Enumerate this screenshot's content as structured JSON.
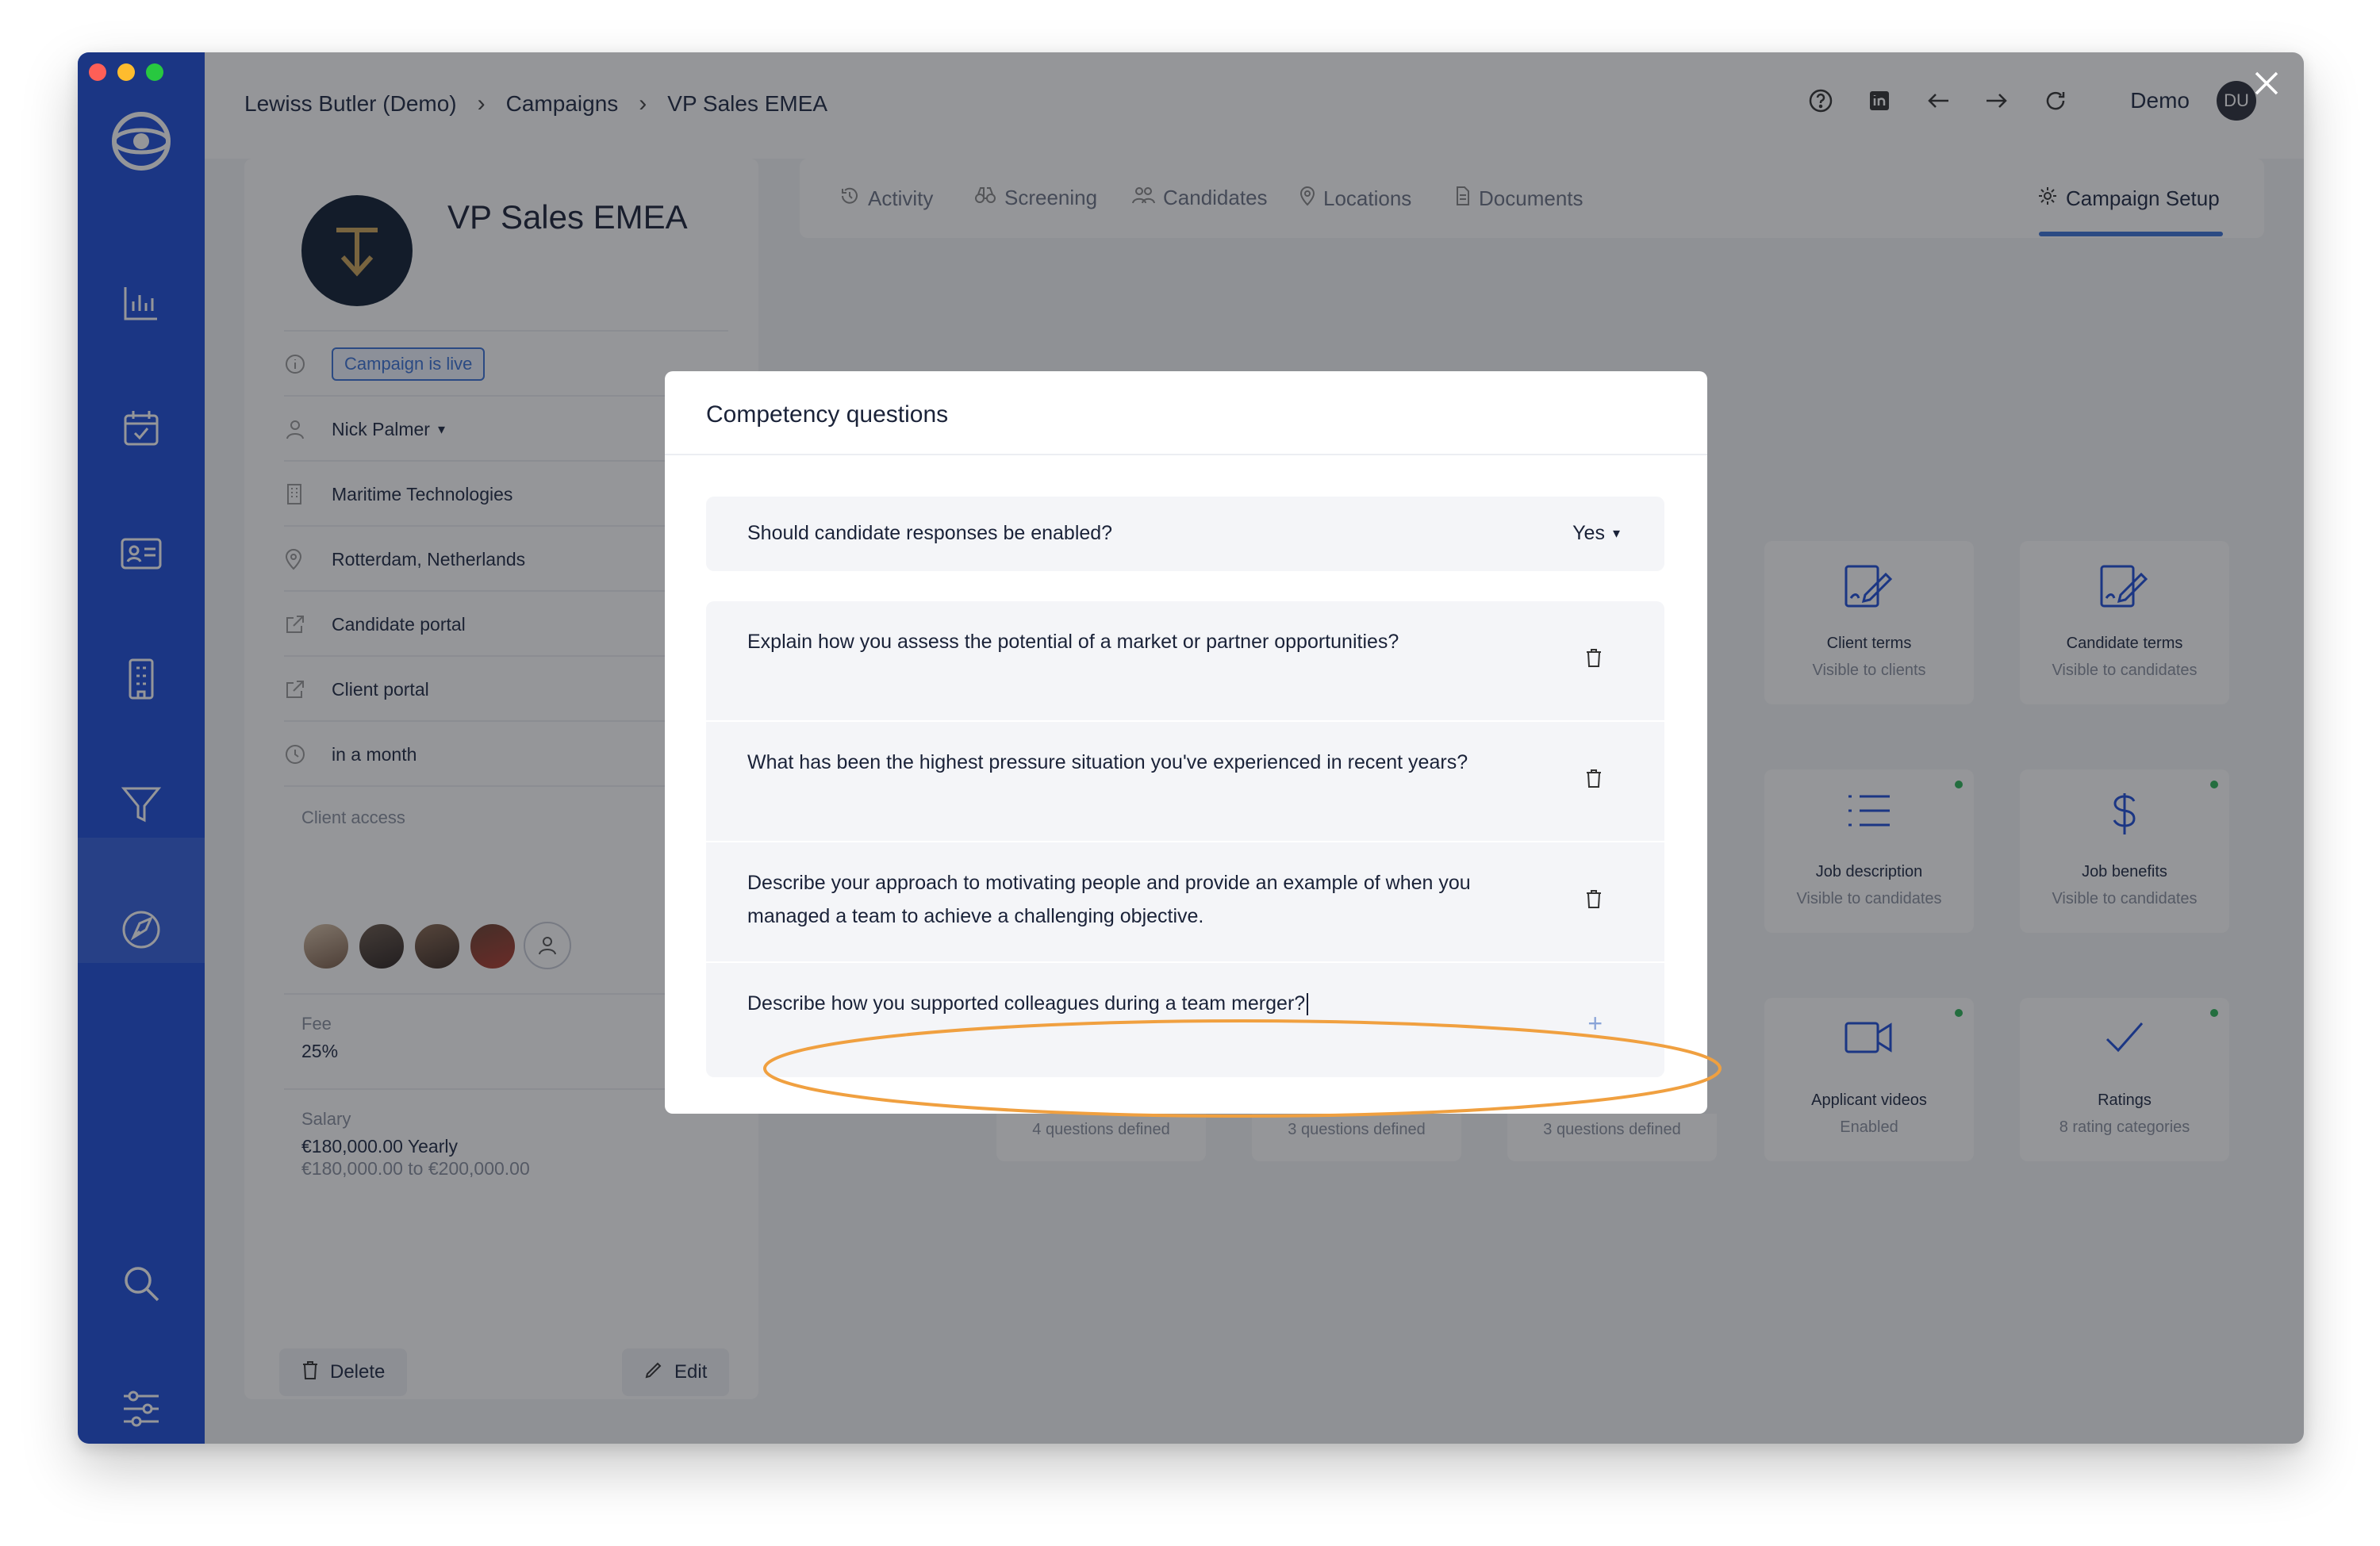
{
  "breadcrumb": [
    "Lewiss Butler (Demo)",
    "Campaigns",
    "VP Sales EMEA"
  ],
  "user": {
    "name": "Demo",
    "initials": "DU"
  },
  "job": {
    "title": "VP Sales EMEA",
    "status": "Campaign is live",
    "owner": "Nick Palmer",
    "company": "Maritime Technologies",
    "location": "Rotterdam, Netherlands",
    "candidate_portal": "Candidate portal",
    "client_portal": "Client portal",
    "deadline": "in a month",
    "client_access_label": "Client access",
    "fee_label": "Fee",
    "fee_value": "25%",
    "salary_label": "Salary",
    "salary_value": "€180,000.00 Yearly",
    "salary_range": "€180,000.00 to €200,000.00",
    "delete_label": "Delete",
    "edit_label": "Edit"
  },
  "tabs": [
    "Activity",
    "Screening",
    "Candidates",
    "Locations",
    "Documents",
    "Campaign Setup"
  ],
  "cards": [
    {
      "title": "Client terms",
      "subtitle": "Visible to clients"
    },
    {
      "title": "Candidate terms",
      "subtitle": "Visible to candidates"
    },
    {
      "title": "Job description",
      "subtitle": "Visible to candidates"
    },
    {
      "title": "Job benefits",
      "subtitle": "Visible to candidates"
    },
    {
      "title": "Applicant videos",
      "subtitle": "Enabled"
    },
    {
      "title": "Ratings",
      "subtitle": "8 rating categories"
    }
  ],
  "partial_cards": [
    "4 questions defined",
    "3 questions defined",
    "3 questions defined"
  ],
  "modal": {
    "title": "Competency questions",
    "toggle_label": "Should candidate responses be enabled?",
    "toggle_value": "Yes",
    "questions": [
      "Explain how you assess the potential of a market or partner opportunities?",
      "What has been the highest pressure situation you've experienced in recent years?",
      "Describe your approach to motivating people and provide an example of when you managed a team to achieve a challenging objective."
    ],
    "new_question_value": "Describe how you supported colleagues during a team merger?",
    "add_symbol": "+"
  },
  "colors": {
    "sidebar": "#1f4fd8",
    "accent": "#3b73d6",
    "highlight": "#f0a040",
    "status_dot": "#2fb55a"
  }
}
